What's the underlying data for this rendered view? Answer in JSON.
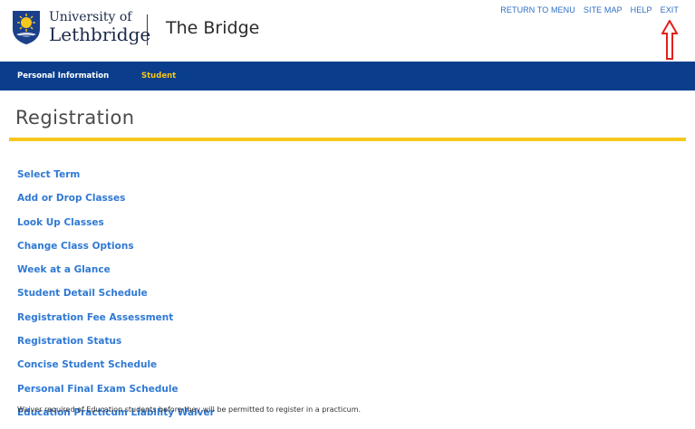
{
  "header": {
    "university_line1": "University of",
    "university_line2": "Lethbridge",
    "app_title": "The Bridge"
  },
  "top_links": [
    {
      "label": "RETURN TO MENU"
    },
    {
      "label": "SITE MAP"
    },
    {
      "label": "HELP"
    },
    {
      "label": "EXIT"
    }
  ],
  "annotation": {
    "icon": "red-up-arrow",
    "color": "#e0201b"
  },
  "nav": {
    "tabs": [
      {
        "label": "Personal Information",
        "active": false
      },
      {
        "label": "Student",
        "active": true
      }
    ]
  },
  "page": {
    "title": "Registration"
  },
  "menu": {
    "items": [
      {
        "label": "Select Term"
      },
      {
        "label": "Add or Drop Classes"
      },
      {
        "label": "Look Up Classes"
      },
      {
        "label": "Change Class Options"
      },
      {
        "label": "Week at a Glance"
      },
      {
        "label": "Student Detail Schedule"
      },
      {
        "label": "Registration Fee Assessment"
      },
      {
        "label": "Registration Status"
      },
      {
        "label": "Concise Student Schedule"
      },
      {
        "label": "Personal Final Exam Schedule"
      },
      {
        "label": "Education Practicum Liability Waiver"
      }
    ],
    "waiver_description": "Waiver required of Education students before they will be permitted to register in a practicum."
  },
  "colors": {
    "nav_background": "#0a3e8c",
    "link_blue": "#2f79d4",
    "accent_gold": "#f6c81c"
  }
}
